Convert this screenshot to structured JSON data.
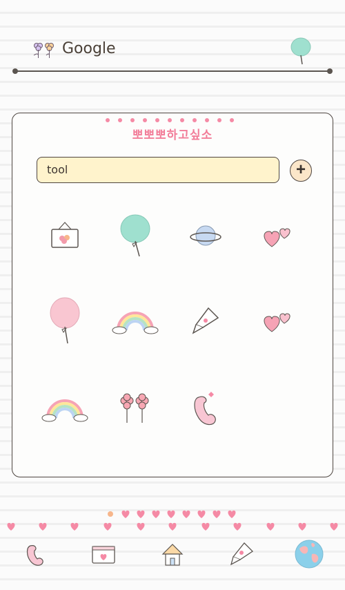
{
  "search": {
    "label": "Google"
  },
  "panel": {
    "title": "뽀뽀뽀하고싶소",
    "folder_name": "tool",
    "add_label": "+"
  },
  "icons": {
    "grid": [
      "calendar-icon",
      "cotton-candy-mint-icon",
      "planet-icon",
      "hearts-icon",
      "cotton-candy-pink-icon",
      "rainbow-icon",
      "paper-plane-icon",
      "hearts-icon",
      "rainbow-icon",
      "flowers-icon",
      "phone-icon"
    ],
    "dock": [
      "phone-icon",
      "calendar-icon",
      "house-icon",
      "paper-plane-icon",
      "globe-icon"
    ]
  },
  "colors": {
    "accent_pink": "#f27d99",
    "input_bg": "#fff3cc",
    "line": "#5b5550"
  }
}
